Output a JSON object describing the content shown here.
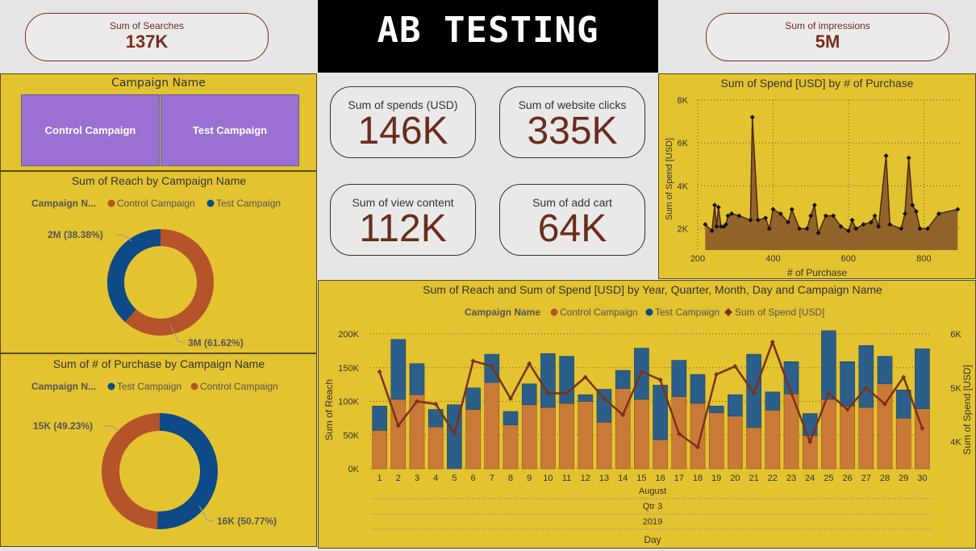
{
  "header": {
    "title": "AB TESTING",
    "searches": {
      "label": "Sum of Searches",
      "value": "137K"
    },
    "impressions": {
      "label": "Sum of impressions",
      "value": "5M"
    }
  },
  "slicer": {
    "title": "Campaign Name",
    "options": [
      "Control Campaign",
      "Test Campaign"
    ]
  },
  "cards": [
    {
      "label": "Sum of spends (USD)",
      "value": "146K"
    },
    {
      "label": "Sum of website clicks",
      "value": "335K"
    },
    {
      "label": "Sum of view content",
      "value": "112K"
    },
    {
      "label": "Sum of add cart",
      "value": "64K"
    }
  ],
  "colors": {
    "control": "#b5532a",
    "test": "#0d4a87",
    "spend": "#7a3119",
    "panel": "#e3c32f"
  },
  "chart_data": [
    {
      "type": "pie",
      "title": "Sum of Reach by Campaign Name",
      "legend_title": "Campaign N...",
      "legend": [
        "Control Campaign",
        "Test Campaign"
      ],
      "slices": [
        {
          "name": "Control Campaign",
          "value": 61.62,
          "label": "3M (61.62%)"
        },
        {
          "name": "Test Campaign",
          "value": 38.38,
          "label": "2M (38.38%)"
        }
      ]
    },
    {
      "type": "pie",
      "title": "Sum of # of Purchase by Campaign Name",
      "legend_title": "Campaign N...",
      "legend": [
        "Test Campaign",
        "Control Campaign"
      ],
      "slices": [
        {
          "name": "Test Campaign",
          "value": 50.77,
          "label": "16K (50.77%)"
        },
        {
          "name": "Control Campaign",
          "value": 49.23,
          "label": "15K (49.23%)"
        }
      ]
    },
    {
      "type": "area",
      "title": "Sum of Spend [USD] by # of Purchase",
      "xlabel": "# of Purchase",
      "ylabel": "Sum of Spend [USD]",
      "xlim": [
        200,
        900
      ],
      "ylim": [
        1000,
        8000
      ],
      "xticks": [
        "200",
        "400",
        "600",
        "800"
      ],
      "yticks": [
        "2K",
        "4K",
        "6K",
        "8K"
      ],
      "x": [
        220,
        238,
        245,
        250,
        255,
        262,
        270,
        275,
        280,
        290,
        310,
        340,
        345,
        360,
        380,
        390,
        400,
        420,
        440,
        450,
        470,
        490,
        500,
        510,
        520,
        540,
        560,
        580,
        600,
        610,
        620,
        640,
        660,
        670,
        680,
        700,
        710,
        740,
        750,
        760,
        770,
        780,
        790,
        810,
        840,
        890
      ],
      "y": [
        2200,
        1900,
        3100,
        2100,
        3000,
        2100,
        2100,
        2200,
        2600,
        2700,
        2600,
        2400,
        7200,
        2400,
        2500,
        2000,
        2900,
        2700,
        2300,
        2900,
        2000,
        2000,
        2600,
        3100,
        1800,
        2600,
        2600,
        2100,
        1900,
        2400,
        2000,
        2200,
        2300,
        2600,
        2100,
        5400,
        2200,
        2000,
        2700,
        5300,
        3100,
        2800,
        2000,
        2000,
        2700,
        2900
      ]
    },
    {
      "type": "bar",
      "title": "Sum of Reach and Sum of Spend [USD] by Year, Quarter, Month, Day and Campaign Name",
      "legend_title": "Campaign Name",
      "legend": [
        "Control Campaign",
        "Test Campaign",
        "Sum of Spend [USD]"
      ],
      "xlabel": "Day",
      "ylabel": "Sum of Reach",
      "y2label": "Sum of Spend [USD]",
      "hierarchy": [
        "August",
        "Qtr 3",
        "2019"
      ],
      "yticks": [
        "0K",
        "50K",
        "100K",
        "150K",
        "200K"
      ],
      "y2ticks": [
        "4K",
        "5K",
        "6K"
      ],
      "ylim": [
        0,
        200000
      ],
      "y2lim": [
        3500,
        6000
      ],
      "categories": [
        "1",
        "2",
        "3",
        "4",
        "5",
        "6",
        "7",
        "8",
        "9",
        "10",
        "11",
        "12",
        "13",
        "14",
        "15",
        "16",
        "17",
        "18",
        "19",
        "20",
        "21",
        "22",
        "23",
        "24",
        "25",
        "26",
        "27",
        "28",
        "29",
        "30"
      ],
      "series": [
        {
          "name": "Control Campaign",
          "values": [
            57000,
            103000,
            110000,
            62000,
            0,
            88000,
            128000,
            65000,
            95000,
            91000,
            97000,
            100000,
            69000,
            119000,
            103000,
            43000,
            107000,
            97000,
            83000,
            78000,
            61000,
            87000,
            111000,
            49000,
            103000,
            93000,
            91000,
            126000,
            75000,
            89000
          ]
        },
        {
          "name": "Test Campaign",
          "values": [
            36000,
            89000,
            46000,
            26000,
            95000,
            32000,
            42000,
            20000,
            31000,
            80000,
            70000,
            10000,
            49000,
            27000,
            76000,
            81000,
            54000,
            43000,
            10000,
            32000,
            109000,
            27000,
            48000,
            33000,
            102000,
            66000,
            92000,
            41000,
            42000,
            89000
          ]
        },
        {
          "name": "Sum of Spend [USD]",
          "values": [
            5300,
            4300,
            4750,
            4700,
            4150,
            5500,
            5400,
            4800,
            5450,
            4900,
            4900,
            5200,
            4800,
            4500,
            5300,
            5150,
            4150,
            3900,
            5250,
            5400,
            4900,
            5850,
            4900,
            4000,
            4900,
            4600,
            5000,
            4700,
            5200,
            4250
          ]
        }
      ]
    }
  ]
}
